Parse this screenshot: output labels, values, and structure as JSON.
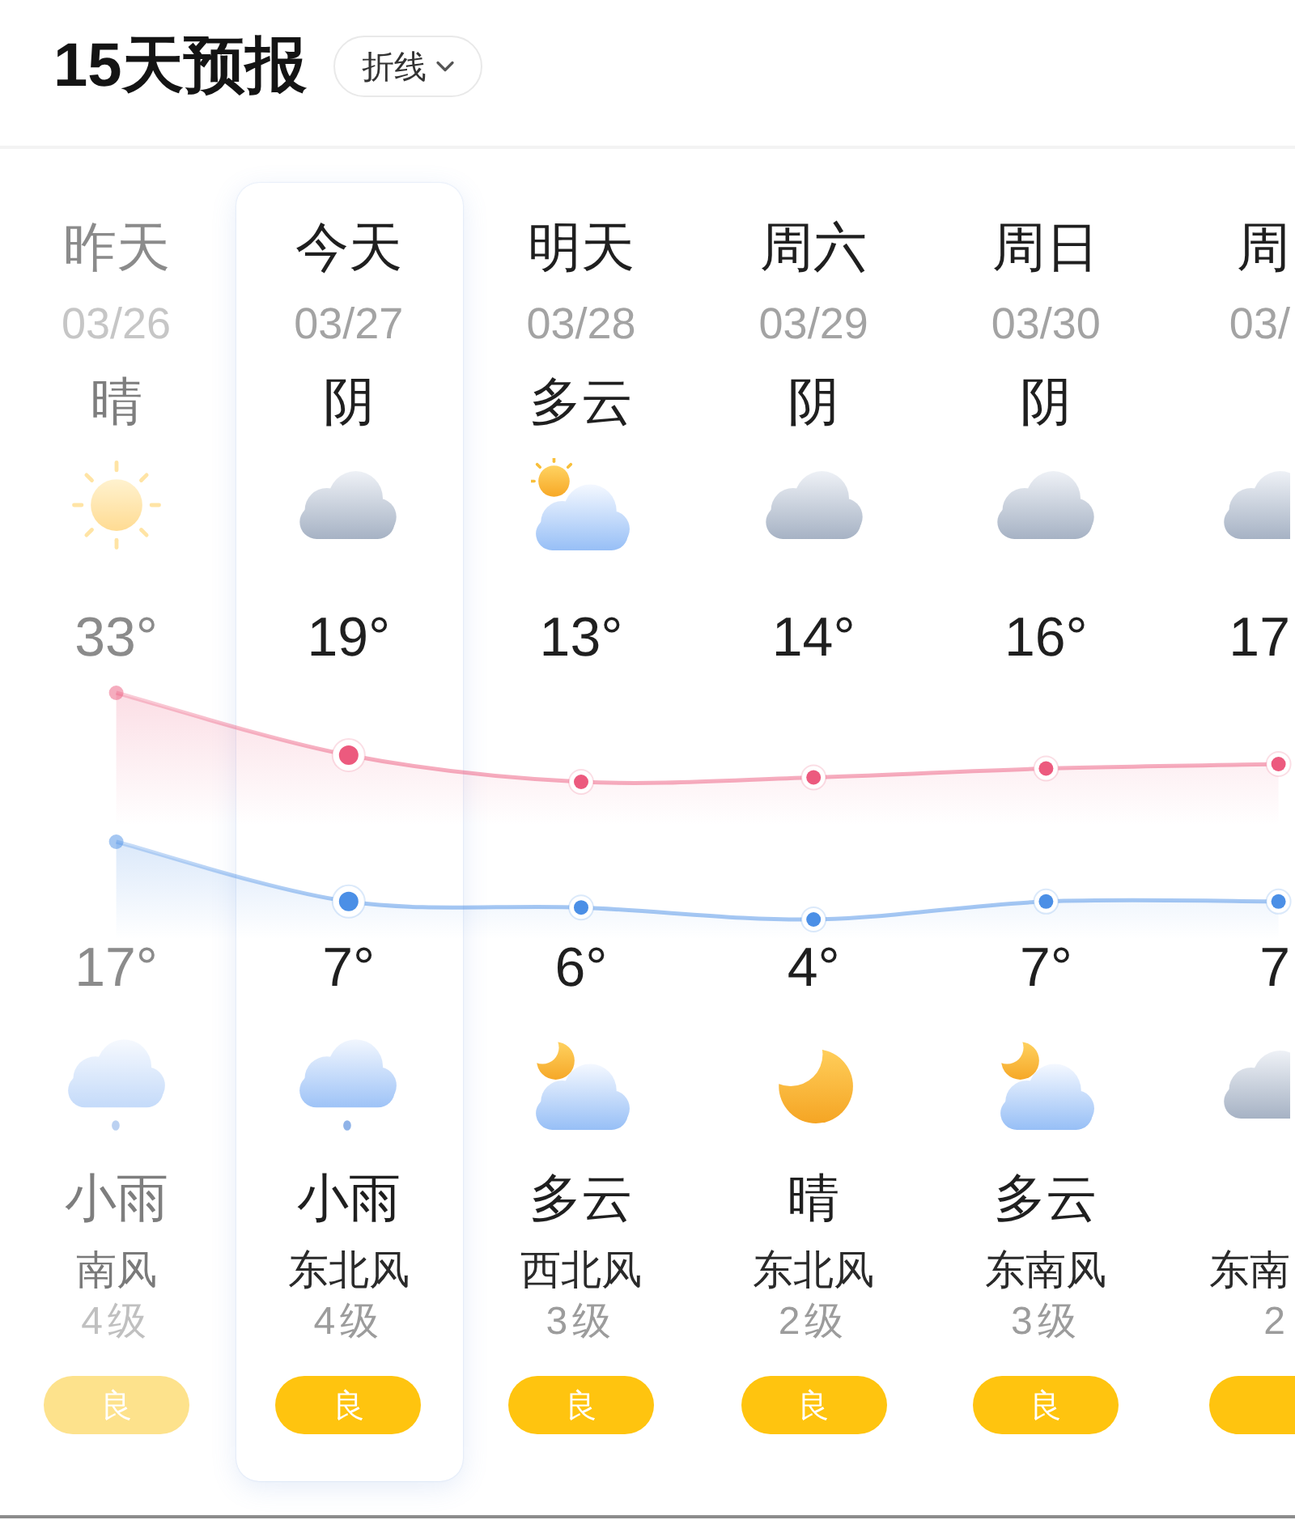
{
  "header": {
    "title": "15天预报",
    "chart_style": "折线"
  },
  "days": [
    {
      "day": "昨天",
      "date": "03/26",
      "past": true,
      "selected": false,
      "daytime": {
        "weather": "晴",
        "kind": "sun"
      },
      "night": {
        "weather": "小雨",
        "kind": "rain"
      },
      "wind": "南风",
      "wind_level": "4级",
      "air_quality": "良"
    },
    {
      "day": "今天",
      "date": "03/27",
      "past": false,
      "selected": true,
      "daytime": {
        "weather": "阴",
        "kind": "cloud"
      },
      "night": {
        "weather": "小雨",
        "kind": "rain"
      },
      "wind": "东北风",
      "wind_level": "4级",
      "air_quality": "良"
    },
    {
      "day": "明天",
      "date": "03/28",
      "past": false,
      "selected": false,
      "daytime": {
        "weather": "多云",
        "kind": "sun-cloud"
      },
      "night": {
        "weather": "多云",
        "kind": "moon-cloud"
      },
      "wind": "西北风",
      "wind_level": "3级",
      "air_quality": "良"
    },
    {
      "day": "周六",
      "date": "03/29",
      "past": false,
      "selected": false,
      "daytime": {
        "weather": "阴",
        "kind": "cloud"
      },
      "night": {
        "weather": "晴",
        "kind": "moon"
      },
      "wind": "东北风",
      "wind_level": "2级",
      "air_quality": "良"
    },
    {
      "day": "周日",
      "date": "03/30",
      "past": false,
      "selected": false,
      "daytime": {
        "weather": "阴",
        "kind": "cloud"
      },
      "night": {
        "weather": "多云",
        "kind": "moon-cloud"
      },
      "wind": "东南风",
      "wind_level": "3级",
      "air_quality": "良"
    },
    {
      "day": "周",
      "date": "03/",
      "past": false,
      "selected": false,
      "daytime": {
        "kind": "cloud"
      },
      "night": {
        "kind": "cloud"
      },
      "wind": "东南",
      "wind_level": "2"
    }
  ],
  "high_temps": {
    "chart_data": {
      "type": "area",
      "data_labels": true,
      "series": [
        {
          "color": "#ec5a7e",
          "marker": "circle",
          "values": [
            33,
            19,
            13,
            14,
            16,
            17
          ],
          "value_labels": [
            "33°",
            "19°",
            "13°",
            "14°",
            "16°",
            "17"
          ]
        }
      ]
    }
  },
  "low_temps": {
    "chart_data": {
      "type": "area",
      "data_labels": true,
      "series": [
        {
          "color": "#4b8fe6",
          "marker": "circle",
          "values": [
            17,
            7,
            6,
            4,
            7,
            7
          ],
          "value_labels": [
            "17°",
            "7°",
            "6°",
            "4°",
            "7°",
            "7"
          ]
        }
      ]
    }
  }
}
